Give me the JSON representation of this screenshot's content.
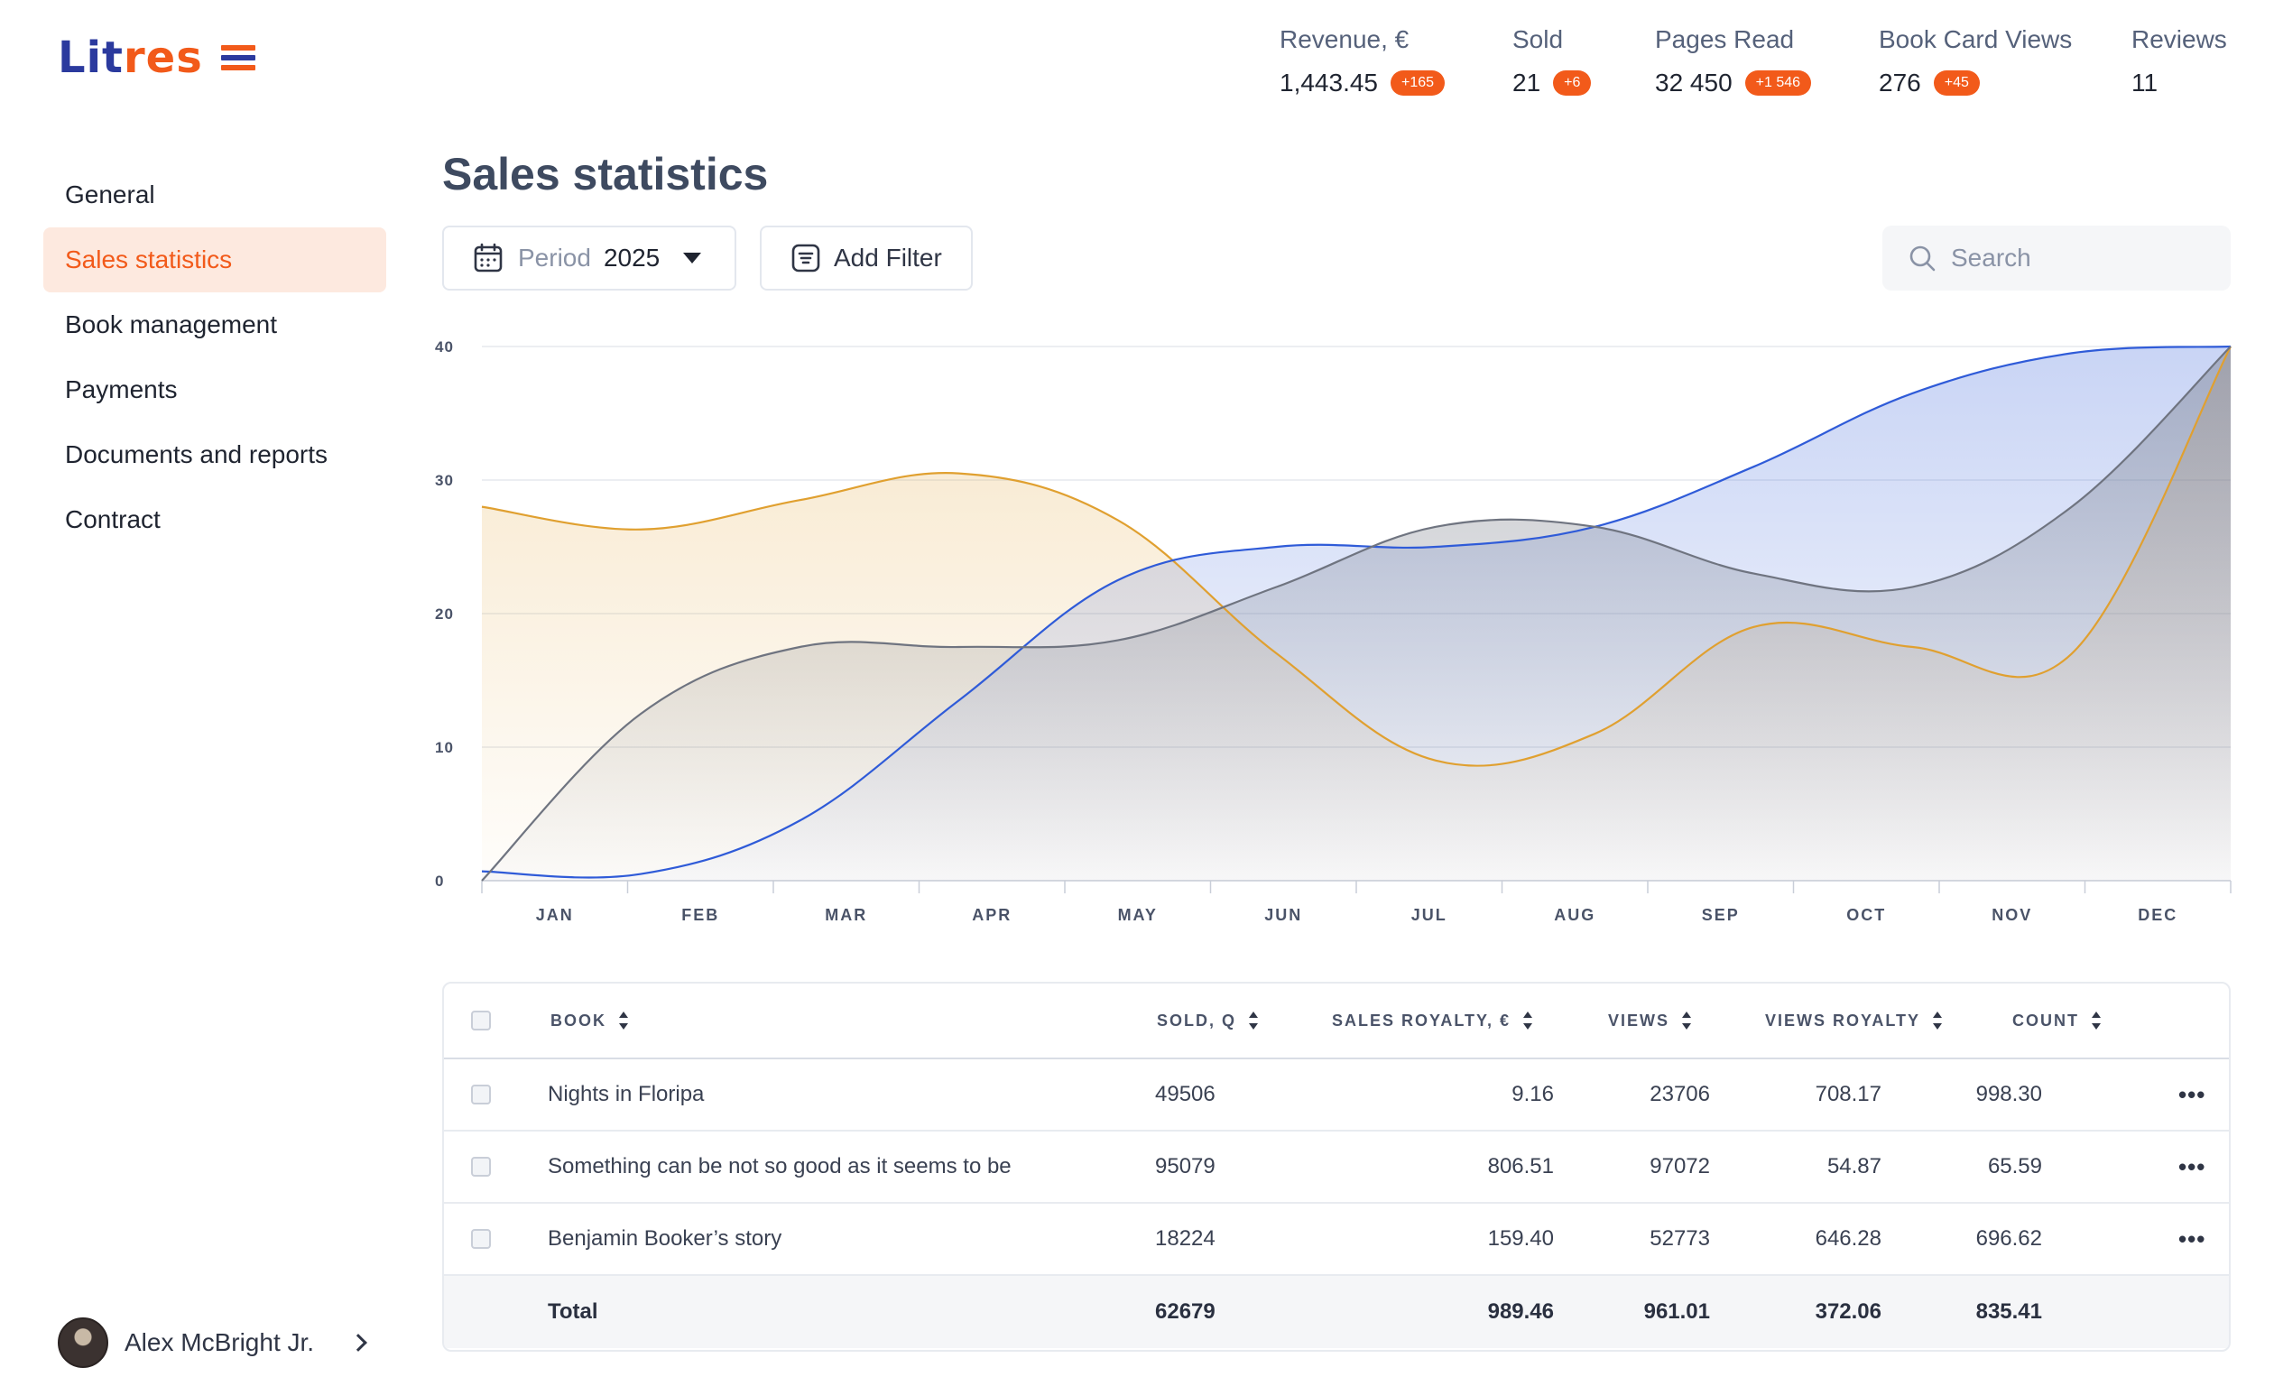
{
  "logo": {
    "part1": "Lit",
    "part2": "res"
  },
  "stats": [
    {
      "label": "Revenue, €",
      "value": "1,443.45",
      "badge": "+165"
    },
    {
      "label": "Sold",
      "value": "21",
      "badge": "+6"
    },
    {
      "label": "Pages Read",
      "value": "32 450",
      "badge": "+1 546"
    },
    {
      "label": "Book Card Views",
      "value": "276",
      "badge": "+45"
    },
    {
      "label": "Reviews",
      "value": "11"
    }
  ],
  "sidebar": {
    "items": [
      {
        "label": "General"
      },
      {
        "label": "Sales statistics",
        "active": true
      },
      {
        "label": "Book management"
      },
      {
        "label": "Payments"
      },
      {
        "label": "Documents and reports"
      },
      {
        "label": "Contract"
      }
    ],
    "user": {
      "name": "Alex McBright Jr."
    }
  },
  "page": {
    "title": "Sales statistics"
  },
  "toolbar": {
    "period_label": "Period",
    "period_value": "2025",
    "filter_label": "Add Filter",
    "search_placeholder": "Search"
  },
  "colors": {
    "accent": "#f25a1a",
    "accent_light": "#fde9df",
    "series_orange": "#e0a030",
    "series_blue": "#2f5bd8",
    "series_gray": "#6f7480"
  },
  "chart_data": {
    "type": "area",
    "categories": [
      "JAN",
      "FEB",
      "MAR",
      "APR",
      "MAY",
      "JUN",
      "JUL",
      "AUG",
      "SEP",
      "OCT",
      "NOV",
      "DEC"
    ],
    "yticks": [
      0,
      10,
      20,
      30,
      40
    ],
    "ylim": [
      0,
      40
    ],
    "grid": true,
    "series": [
      {
        "color": "#e0a030",
        "values": [
          28,
          26.3,
          28.5,
          30.5,
          27,
          17,
          9,
          11,
          19,
          17.5,
          17,
          40
        ]
      },
      {
        "color": "#2f5bd8",
        "values": [
          0.7,
          0.5,
          4.5,
          13.5,
          22.5,
          25,
          25,
          26.5,
          31,
          36.5,
          39.5,
          40
        ]
      },
      {
        "color": "#6f7480",
        "values": [
          0,
          12.5,
          17.5,
          17.5,
          18,
          22,
          26.5,
          26.5,
          23,
          22,
          28,
          40
        ]
      }
    ]
  },
  "table": {
    "headers": {
      "book": "BOOK",
      "sold": "SOLD, Q",
      "sales_royalty": "SALES ROYALTY, €",
      "views": "VIEWS",
      "views_royalty": "VIEWS ROYALTY",
      "count": "COUNT"
    },
    "rows": [
      {
        "book": "Nights in Floripa",
        "sold": "49506",
        "sales_royalty": "9.16",
        "views": "23706",
        "views_royalty": "708.17",
        "count": "998.30"
      },
      {
        "book": "Something can be not so good as it seems to be",
        "sold": "95079",
        "sales_royalty": "806.51",
        "views": "97072",
        "views_royalty": "54.87",
        "count": "65.59"
      },
      {
        "book": "Benjamin Booker’s story",
        "sold": "18224",
        "sales_royalty": "159.40",
        "views": "52773",
        "views_royalty": "646.28",
        "count": "696.62"
      }
    ],
    "total": {
      "label": "Total",
      "sold": "62679",
      "sales_royalty": "989.46",
      "views": "961.01",
      "views_royalty": "372.06",
      "count": "835.41"
    },
    "row_menu": "•••"
  }
}
